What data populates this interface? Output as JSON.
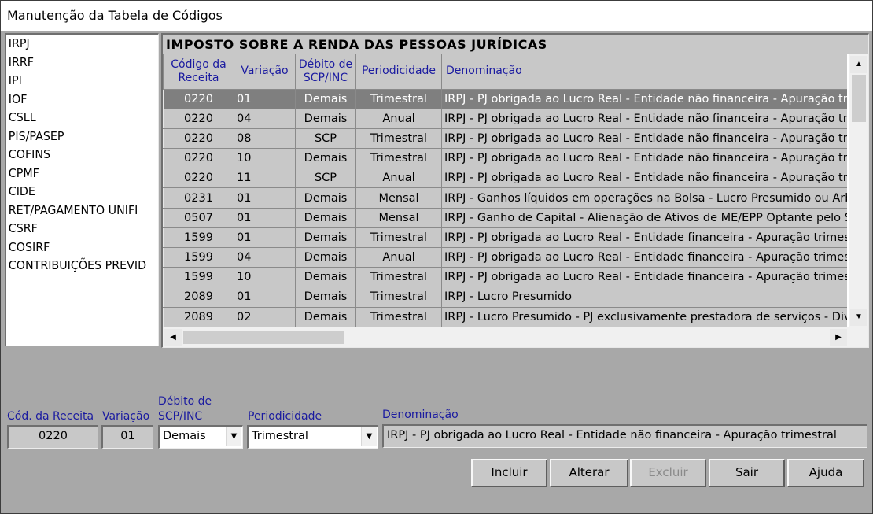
{
  "window": {
    "title": "Manutenção da Tabela de Códigos"
  },
  "tax_list": [
    "IRPJ",
    "IRRF",
    "IPI",
    "IOF",
    "CSLL",
    "PIS/PASEP",
    "COFINS",
    "CPMF",
    "CIDE",
    "RET/PAGAMENTO UNIFI",
    "CSRF",
    "COSIRF",
    "CONTRIBUIÇÕES PREVID"
  ],
  "grid": {
    "caption": "IMPOSTO SOBRE A RENDA DAS PESSOAS JURÍDICAS",
    "headers": {
      "codigo_l1": "Código da",
      "codigo_l2": "Receita",
      "variacao": "Variação",
      "debito_l1": "Débito de",
      "debito_l2": "SCP/INC",
      "periodicidade": "Periodicidade",
      "denominacao": "Denominação"
    },
    "rows": [
      {
        "codigo": "0220",
        "variacao": "01",
        "debito": "Demais",
        "periodicidade": "Trimestral",
        "denominacao": "IRPJ - PJ obrigada ao Lucro Real - Entidade não financeira - Apuração trimestral"
      },
      {
        "codigo": "0220",
        "variacao": "04",
        "debito": "Demais",
        "periodicidade": "Anual",
        "denominacao": "IRPJ - PJ obrigada ao Lucro Real - Entidade não financeira - Apuração trimestral"
      },
      {
        "codigo": "0220",
        "variacao": "08",
        "debito": "SCP",
        "periodicidade": "Trimestral",
        "denominacao": "IRPJ - PJ obrigada ao Lucro Real - Entidade não financeira - Apuração trimestral"
      },
      {
        "codigo": "0220",
        "variacao": "10",
        "debito": "Demais",
        "periodicidade": "Trimestral",
        "denominacao": "IRPJ - PJ obrigada ao Lucro Real - Entidade não financeira - Apuração trimestral"
      },
      {
        "codigo": "0220",
        "variacao": "11",
        "debito": "SCP",
        "periodicidade": "Anual",
        "denominacao": "IRPJ - PJ obrigada ao Lucro Real - Entidade não financeira - Apuração trimestral"
      },
      {
        "codigo": "0231",
        "variacao": "01",
        "debito": "Demais",
        "periodicidade": "Mensal",
        "denominacao": "IRPJ - Ganhos líquidos em operações na Bolsa - Lucro Presumido ou Arbitrado"
      },
      {
        "codigo": "0507",
        "variacao": "01",
        "debito": "Demais",
        "periodicidade": "Mensal",
        "denominacao": "IRPJ - Ganho de Capital - Alienação de Ativos de ME/EPP Optante pelo Simples"
      },
      {
        "codigo": "1599",
        "variacao": "01",
        "debito": "Demais",
        "periodicidade": "Trimestral",
        "denominacao": "IRPJ - PJ obrigada ao Lucro Real - Entidade financeira - Apuração trimestral"
      },
      {
        "codigo": "1599",
        "variacao": "04",
        "debito": "Demais",
        "periodicidade": "Anual",
        "denominacao": "IRPJ - PJ obrigada ao Lucro Real - Entidade financeira - Apuração trimestral"
      },
      {
        "codigo": "1599",
        "variacao": "10",
        "debito": "Demais",
        "periodicidade": "Trimestral",
        "denominacao": "IRPJ - PJ obrigada ao Lucro Real - Entidade financeira - Apuração trimestral"
      },
      {
        "codigo": "2089",
        "variacao": "01",
        "debito": "Demais",
        "periodicidade": "Trimestral",
        "denominacao": "IRPJ - Lucro Presumido"
      },
      {
        "codigo": "2089",
        "variacao": "02",
        "debito": "Demais",
        "periodicidade": "Trimestral",
        "denominacao": "IRPJ - Lucro Presumido - PJ exclusivamente prestadora de serviços - Diversas"
      }
    ]
  },
  "form": {
    "cod_label": "Cód. da Receita",
    "cod_value": "0220",
    "var_label": "Variação",
    "var_value": "01",
    "deb_label_l1": "Débito de",
    "deb_label_l2": "SCP/INC",
    "deb_value": "Demais",
    "per_label": "Periodicidade",
    "per_value": "Trimestral",
    "den_label": "Denominação",
    "den_value": "IRPJ - PJ obrigada ao Lucro Real - Entidade não financeira - Apuração trimestral"
  },
  "buttons": {
    "incluir": "Incluir",
    "alterar": "Alterar",
    "excluir": "Excluir",
    "sair": "Sair",
    "ajuda": "Ajuda"
  },
  "icons": {
    "scroll_up": "arrow-up-icon",
    "scroll_down": "arrow-down-icon",
    "scroll_left": "arrow-left-icon",
    "scroll_right": "arrow-right-icon",
    "dropdown": "chevron-down-icon"
  },
  "colors": {
    "selected_row": "#7f7f7f",
    "label_blue": "#1a1aa0",
    "panel": "#a8a8a8"
  }
}
